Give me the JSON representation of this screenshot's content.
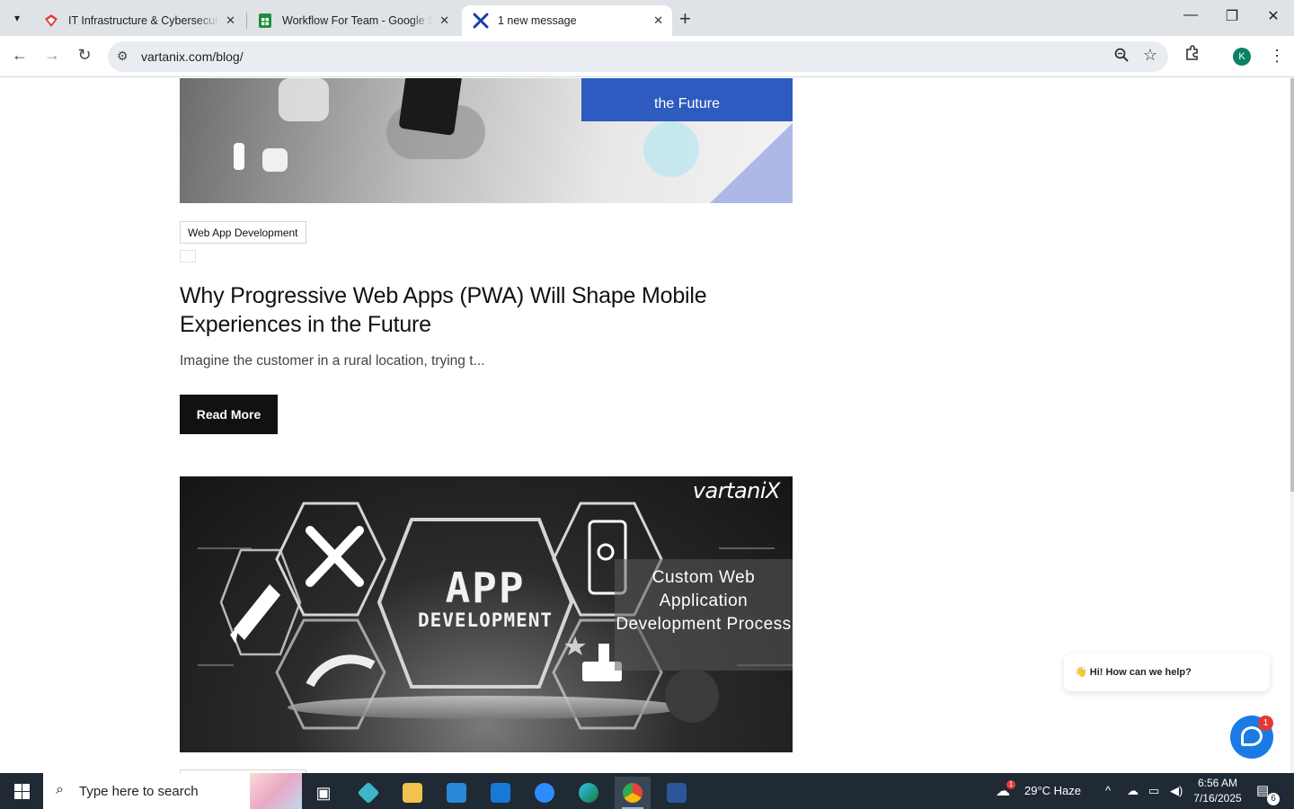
{
  "browser": {
    "tabs": [
      {
        "title": "IT Infrastructure & Cybersecurity",
        "active": false
      },
      {
        "title": "Workflow For Team - Google Sheets",
        "active": false
      },
      {
        "title": "1 new message",
        "active": true
      }
    ],
    "url": "vartanix.com/blog/",
    "profile_initial": "K"
  },
  "page": {
    "hero1_banner": "the Future",
    "post": {
      "category": "Web App Development",
      "title": "Why Progressive Web Apps (PWA) Will Shape Mobile Experiences in the Future",
      "excerpt": "Imagine the customer in a rural location, trying t...",
      "read_more": "Read More"
    },
    "hero2": {
      "brand": "vartaniX",
      "app_line1": "APP",
      "app_line2": "DEVELOPMENT",
      "caption": "Custom Web Application Development Process"
    }
  },
  "chat": {
    "greeting": "👋 Hi! How can we help?",
    "badge": "1"
  },
  "taskbar": {
    "search_placeholder": "Type here to search",
    "weather_badge": "1",
    "weather": "29°C  Haze",
    "time": "6:56 AM",
    "date": "7/16/2025",
    "notifications": "6"
  },
  "colors": {
    "banner_blue": "#2d5bbf",
    "chat_blue": "#1a7be6",
    "taskbar": "#202a35"
  }
}
